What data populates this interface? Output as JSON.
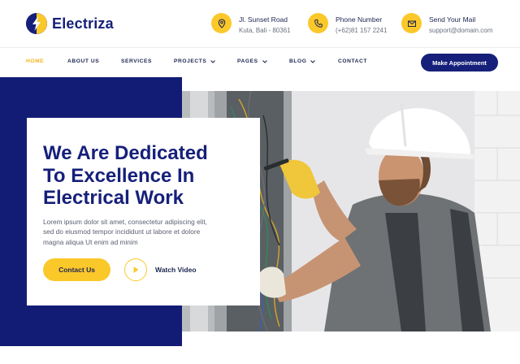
{
  "brand": {
    "name": "Electriza",
    "primary_color": "#16207a",
    "accent_color": "#fbc82a"
  },
  "header_info": [
    {
      "icon": "map-pin-icon",
      "title": "Jl. Sunset Road",
      "subtitle": "Kuta, Bali - 80361"
    },
    {
      "icon": "phone-icon",
      "title": "Phone Number",
      "subtitle": "(+62)81 157 2241"
    },
    {
      "icon": "mail-icon",
      "title": "Send Your Mail",
      "subtitle": "support@domain.com"
    }
  ],
  "nav": {
    "items": [
      {
        "label": "HOME",
        "active": true,
        "dropdown": false
      },
      {
        "label": "ABOUT US",
        "active": false,
        "dropdown": false
      },
      {
        "label": "SERVICES",
        "active": false,
        "dropdown": false
      },
      {
        "label": "PROJECTS",
        "active": false,
        "dropdown": true
      },
      {
        "label": "PAGES",
        "active": false,
        "dropdown": true
      },
      {
        "label": "BLOG",
        "active": false,
        "dropdown": true
      },
      {
        "label": "CONTACT",
        "active": false,
        "dropdown": false
      }
    ],
    "cta_label": "Make Appointment"
  },
  "hero": {
    "title": "We Are Dedicated\nTo Excellence In\nElectrical Work",
    "description": "Lorem ipsum dolor sit amet, consectetur adipiscing elit, sed do eiusmod tempor incididunt ut labore et dolore magna aliqua Ut enim ad minim",
    "primary_button": "Contact Us",
    "video_label": "Watch Video",
    "image": "electrician-working-on-panel"
  }
}
